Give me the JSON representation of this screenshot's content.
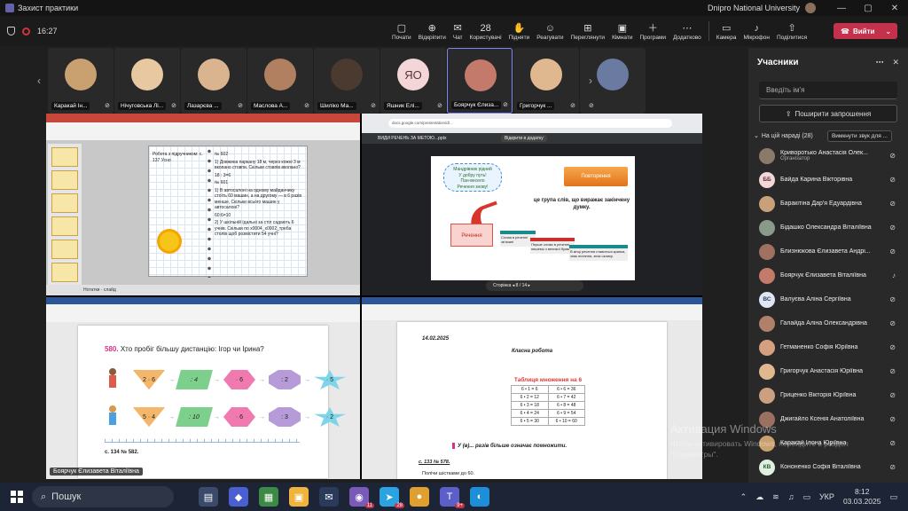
{
  "window": {
    "title": "Захист практики",
    "org": "Dnipro National University"
  },
  "toolbar": {
    "timer": "16:27",
    "items": [
      {
        "icon": "▢",
        "label": "Почати"
      },
      {
        "icon": "⊕",
        "label": "Відкріпити"
      },
      {
        "icon": "✉",
        "label": "Чат"
      },
      {
        "icon": "28",
        "label": "Користувачі"
      },
      {
        "icon": "✋",
        "label": "Підняти"
      },
      {
        "icon": "☺",
        "label": "Реагувати"
      },
      {
        "icon": "⊞",
        "label": "Переглянути"
      },
      {
        "icon": "▣",
        "label": "Кімнати"
      },
      {
        "icon": "＋",
        "label": "Програми"
      },
      {
        "icon": "⋯",
        "label": "Додатково"
      },
      {
        "icon": "▭",
        "label": "Камера"
      },
      {
        "icon": "♪",
        "label": "Мікрофон"
      },
      {
        "icon": "⇧",
        "label": "Поділитися"
      }
    ],
    "leave": "Вийти"
  },
  "strip": [
    {
      "label": "Каракай Ін...",
      "color": "#c9a070",
      "initials": ""
    },
    {
      "label": "Нічуговська Лі...",
      "color": "#e8c8a0",
      "initials": ""
    },
    {
      "label": "Лазарєва ...",
      "color": "#d9b48f",
      "initials": ""
    },
    {
      "label": "Маслова А...",
      "color": "#b08060",
      "initials": ""
    },
    {
      "label": "Шиліко Ма...",
      "color": "#4a3a30",
      "initials": ""
    },
    {
      "label": "Яшник Елі...",
      "color": "#f3d6d8",
      "initials": "ЯО"
    },
    {
      "label": "Боярчук Єлиза...",
      "color": "#c47a6a",
      "initials": ""
    },
    {
      "label": "Григорчук ...",
      "color": "#e0b890",
      "initials": ""
    },
    {
      "label": "",
      "color": "#6a7aa0",
      "initials": ""
    }
  ],
  "q1": {
    "left_text": "Робота з підручником: с. 137 Усно",
    "right_lines": [
      "№ 602",
      "1) Довжина паркану 18 м, через кожні 3 м вкопано стовпи. Скільки стовпів вкопано?",
      "18 : 3=6",
      "№ 601",
      "1) В автосалоні на одному майданчику стоїть 60 машин, а на другому — в 6 разів менше. Скільки всього машин у автосалоні?",
      "60:6=10",
      "2) У шкільній їдальні за стіл садають 6 учнів. Скільки по х0004_х0002_треба столів щоб розмістити 54 учні?"
    ],
    "status": "Нотатки  ·  слайд"
  },
  "q2": {
    "url": "docs.google.com/presentation/d/...",
    "doc_title": "ВИДИ РЕЧЕНЬ ЗА МЕТОЮ...pptx",
    "open_label": "Відкрити в додатку",
    "cloud": [
      "Мандрівник рідний",
      "У добру путь!",
      "Пан-весело",
      "Речення знову!"
    ],
    "repeat": "Повторення",
    "slide_text": "це група слів, що виражає закінчену думку.",
    "rechennia": "Речення",
    "steps": [
      "Слова в реченні зв'язані",
      "Перше слово в реченні пишемо з великої букви.",
      "В кінці речення ставиться крапка, знак питання, знак оклику."
    ],
    "pager": "Сторінка  ◂  8  /  14  ▸"
  },
  "q3": {
    "task_num": "580.",
    "task": "Хто пробіг більшу дистанцію: Ігор чи Ірина?",
    "row1": [
      "2 · 6",
      ": 4",
      "· 6",
      ": 2",
      "· 5"
    ],
    "row2": [
      "5 · 4",
      ": 10",
      "· 6",
      ": 3",
      "· 2"
    ],
    "foot": "с. 134 № 582.",
    "name_tag": "Боярчук Єлизавета Віталіївна"
  },
  "q4": {
    "date": "14.02.2025",
    "classwork": "Класна робота",
    "table_caption": "Таблиця множення на 6",
    "table": [
      [
        "6 • 1 = 6",
        "6 • 6 = 36"
      ],
      [
        "6 • 2 = 12",
        "6 • 7 = 42"
      ],
      [
        "6 • 3 = 18",
        "6 • 8 = 48"
      ],
      [
        "6 • 4 = 24",
        "6 • 9 = 54"
      ],
      [
        "6 • 5 = 30",
        "6 • 10 = 60"
      ]
    ],
    "rule": "У (в)... разів більше означає помножити.",
    "task_ref": "с. 133 № 578.",
    "task_line": "Полічи шістками до 60."
  },
  "panel": {
    "title": "Учасники",
    "search_placeholder": "Введіть ім'я",
    "share": "Поширити запрошення",
    "in_meeting": "На цій нараді (28)",
    "mute_all": "Вимкнути звук для ...",
    "participants": [
      {
        "name": "Криворотько Анастасія Олек...",
        "role": "Організатор",
        "initials": "",
        "bg": "#8a7a6a",
        "fg": "#fff"
      },
      {
        "name": "Байда Карина Вікторівна",
        "role": "",
        "initials": "ББ",
        "bg": "#f3d6d8",
        "fg": "#5a3338"
      },
      {
        "name": "Баракітіна Дар'я Едуардівна",
        "role": "",
        "initials": "",
        "bg": "#c9a07a",
        "fg": "#fff"
      },
      {
        "name": "Бідашко Олександра Віталіївна",
        "role": "",
        "initials": "",
        "bg": "#8a9a8a",
        "fg": "#fff"
      },
      {
        "name": "Близнюкова Єлизавета Андрі...",
        "role": "",
        "initials": "",
        "bg": "#a07060",
        "fg": "#fff"
      },
      {
        "name": "Боярчук Єлизавета Віталіївна",
        "role": "",
        "initials": "",
        "bg": "#c47a6a",
        "fg": "#fff"
      },
      {
        "name": "Валуєва Аліна Сергіївна",
        "role": "",
        "initials": "ВС",
        "bg": "#dfe6f4",
        "fg": "#304060"
      },
      {
        "name": "Галайда Аліна Олександрівна",
        "role": "",
        "initials": "",
        "bg": "#b0806a",
        "fg": "#fff"
      },
      {
        "name": "Гетманенко Софія Юріївна",
        "role": "",
        "initials": "",
        "bg": "#d4a080",
        "fg": "#fff"
      },
      {
        "name": "Григорчук Анастасія Юріївна",
        "role": "",
        "initials": "",
        "bg": "#e0b890",
        "fg": "#fff"
      },
      {
        "name": "Гриценко Вікторія Юріївна",
        "role": "",
        "initials": "",
        "bg": "#caa080",
        "fg": "#fff"
      },
      {
        "name": "Джигайло Ксенія Анатоліївна",
        "role": "",
        "initials": "",
        "bg": "#9a7060",
        "fg": "#fff"
      },
      {
        "name": "Каракай Ілона Юріївна",
        "role": "",
        "initials": "",
        "bg": "#c9a070",
        "fg": "#fff"
      },
      {
        "name": "Кононенко Софія Віталіївна",
        "role": "",
        "initials": "КВ",
        "bg": "#dff0e0",
        "fg": "#2d5a30"
      }
    ]
  },
  "watermark": {
    "title": "Активация Windows",
    "sub": "Чтобы активировать Windows, перейдите в раздел \"Параметры\"."
  },
  "taskbar": {
    "search": "Пошук",
    "apps": [
      {
        "icon": "▤",
        "bg": "#3a4a6a",
        "badge": ""
      },
      {
        "icon": "◆",
        "bg": "#4a60d0",
        "badge": ""
      },
      {
        "icon": "▦",
        "bg": "#3d8a46",
        "badge": ""
      },
      {
        "icon": "▣",
        "bg": "#f0b43c",
        "badge": ""
      },
      {
        "icon": "✉",
        "bg": "#2a3a5a",
        "badge": ""
      },
      {
        "icon": "◉",
        "bg": "#7a5ab8",
        "badge": "11"
      },
      {
        "icon": "➤",
        "bg": "#2aa3e0",
        "badge": "28"
      },
      {
        "icon": "●",
        "bg": "#e0a030",
        "badge": ""
      },
      {
        "icon": "T",
        "bg": "#5b5fc7",
        "badge": "9+"
      },
      {
        "icon": "◐",
        "bg": "#1d8fd8",
        "badge": ""
      }
    ],
    "lang": "УКР",
    "time": "8:12",
    "date": "03.03.2025"
  }
}
